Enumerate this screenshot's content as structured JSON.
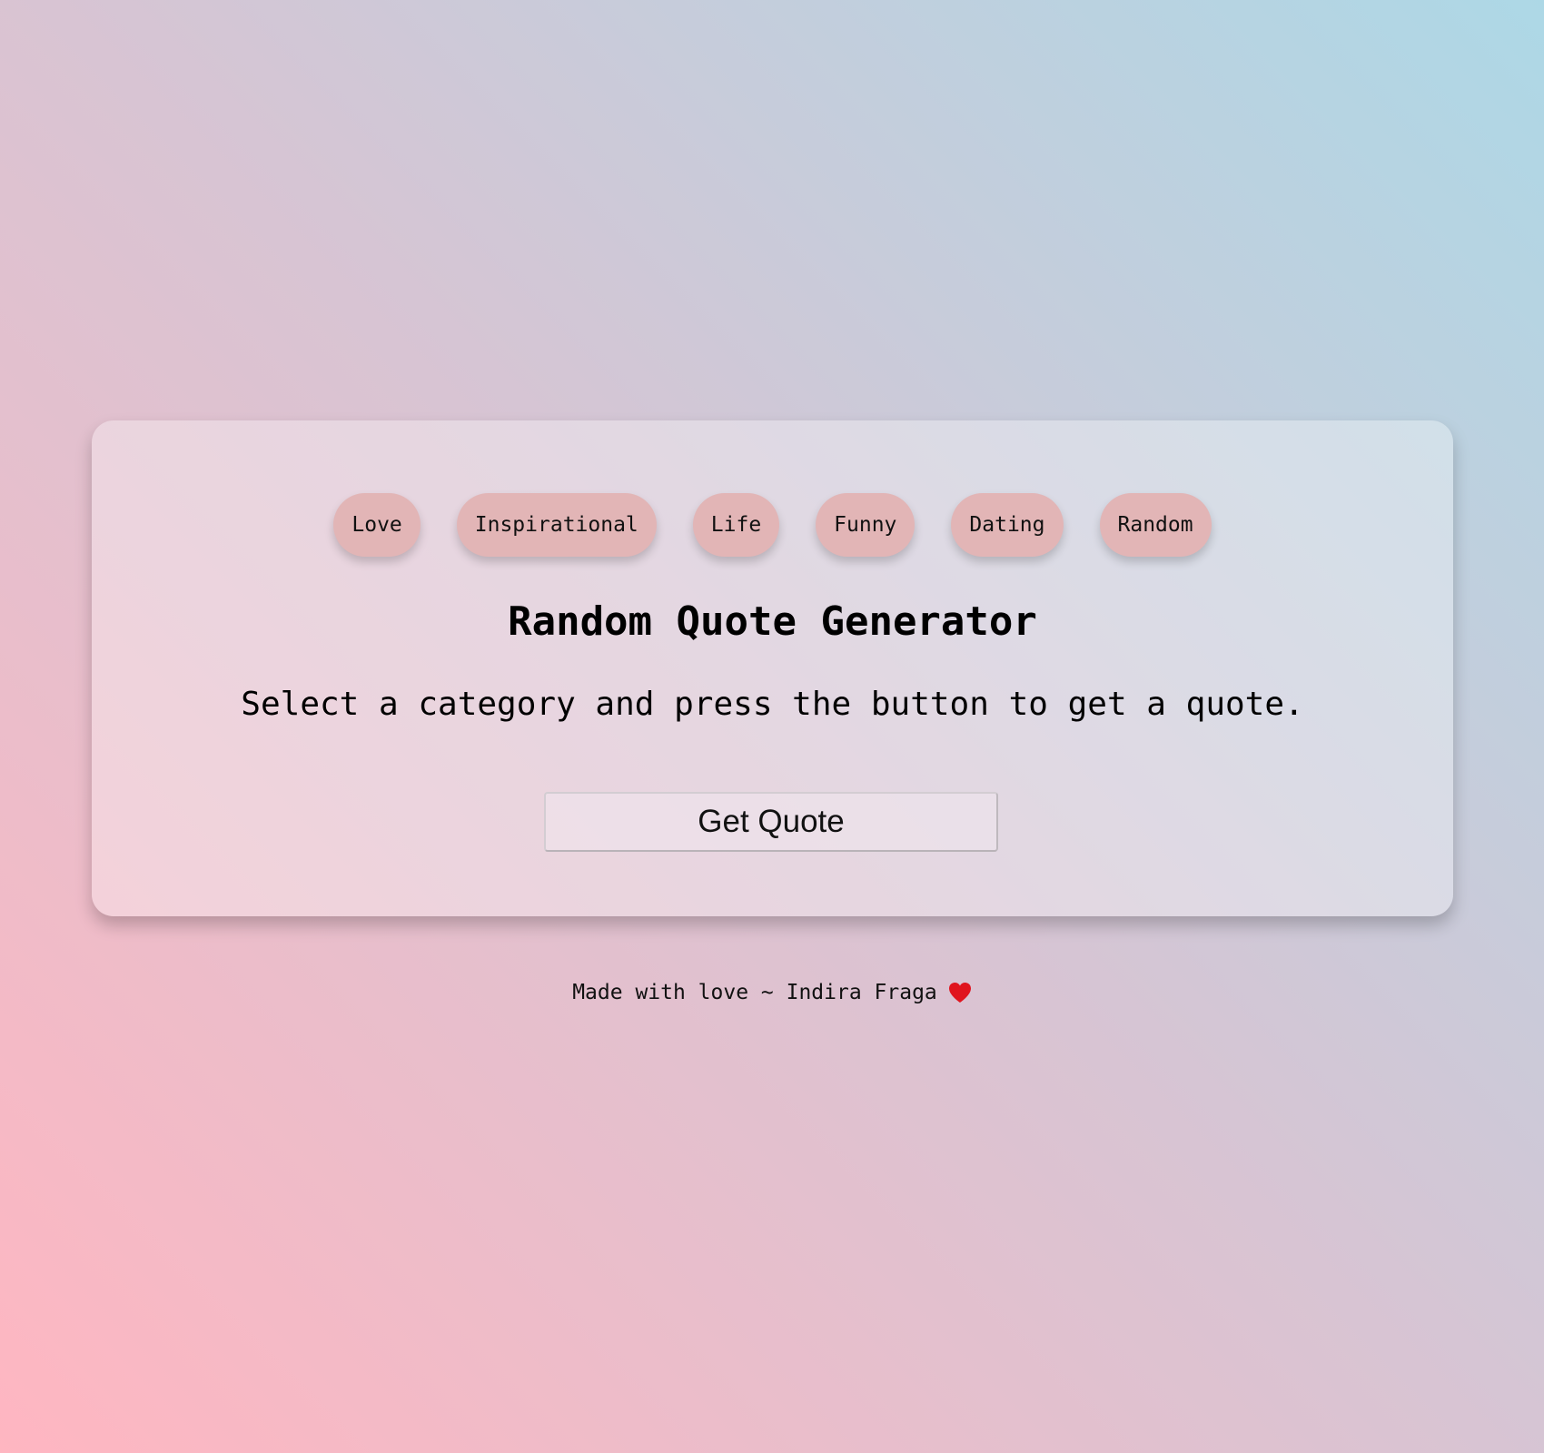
{
  "categories": [
    {
      "label": "Love"
    },
    {
      "label": "Inspirational"
    },
    {
      "label": "Life"
    },
    {
      "label": "Funny"
    },
    {
      "label": "Dating"
    },
    {
      "label": "Random"
    }
  ],
  "main": {
    "title": "Random Quote Generator",
    "subtitle": "Select a category and press the button to get a quote.",
    "button_label": "Get Quote"
  },
  "footer": {
    "text": "Made with love ~ Indira Fraga",
    "icon": "heart-icon"
  },
  "colors": {
    "chip_background": "#e2b5b6",
    "heart": "#e0141e",
    "gradient_start": "#ffb6c1",
    "gradient_end": "#add8e6"
  }
}
